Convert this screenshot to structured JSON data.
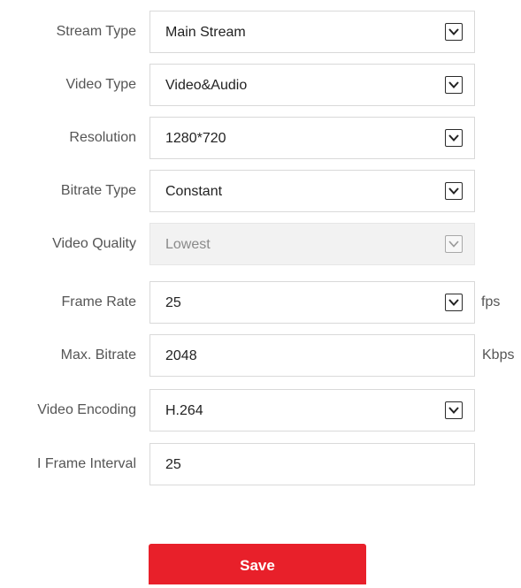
{
  "form": {
    "stream_type": {
      "label": "Stream Type",
      "value": "Main Stream"
    },
    "video_type": {
      "label": "Video Type",
      "value": "Video&Audio"
    },
    "resolution": {
      "label": "Resolution",
      "value": "1280*720"
    },
    "bitrate_type": {
      "label": "Bitrate Type",
      "value": "Constant"
    },
    "video_quality": {
      "label": "Video Quality",
      "value": "Lowest"
    },
    "frame_rate": {
      "label": "Frame Rate",
      "value": "25",
      "unit": "fps"
    },
    "max_bitrate": {
      "label": "Max. Bitrate",
      "value": "2048",
      "unit": "Kbps"
    },
    "video_encoding": {
      "label": "Video Encoding",
      "value": "H.264"
    },
    "i_frame_interval": {
      "label": "I Frame Interval",
      "value": "25"
    }
  },
  "actions": {
    "save_label": "Save"
  }
}
